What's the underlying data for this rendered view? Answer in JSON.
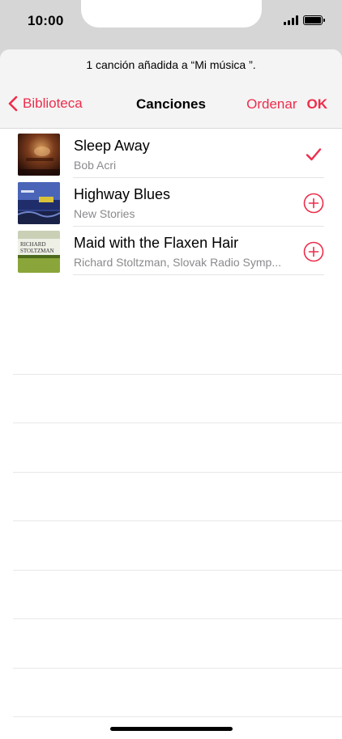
{
  "status_bar": {
    "time": "10:00"
  },
  "banner": {
    "text": "1 canción añadida a “Mi música ”."
  },
  "nav": {
    "back_label": "Biblioteca",
    "title": "Canciones",
    "sort_label": "Ordenar",
    "done_label": "OK"
  },
  "songs": [
    {
      "title": "Sleep Away",
      "artist": "Bob Acri",
      "state": "added"
    },
    {
      "title": "Highway Blues",
      "artist": "New Stories",
      "state": "add"
    },
    {
      "title": "Maid with the Flaxen Hair",
      "artist": "Richard Stoltzman, Slovak Radio Symp...",
      "state": "add"
    }
  ],
  "artwork_text": {
    "song_3_line1": "RICHARD",
    "song_3_line2": "STOLTZMAN"
  },
  "colors": {
    "accent": "#ee2d4b",
    "secondary_text": "#8a8a8e"
  }
}
